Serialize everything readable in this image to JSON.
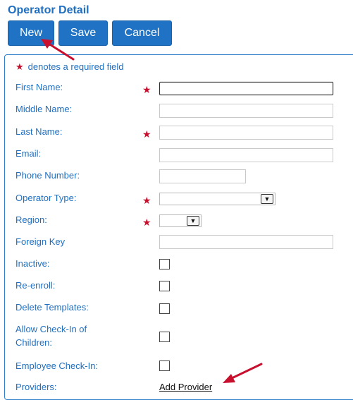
{
  "header": {
    "title": "Operator Detail"
  },
  "toolbar": {
    "new_label": "New",
    "save_label": "Save",
    "cancel_label": "Cancel"
  },
  "form": {
    "required_note": "denotes a required field",
    "required_mark": "★",
    "fields": {
      "first_name": {
        "label": "First Name:",
        "value": ""
      },
      "middle_name": {
        "label": "Middle Name:",
        "value": ""
      },
      "last_name": {
        "label": "Last Name:",
        "value": ""
      },
      "email": {
        "label": "Email:",
        "value": ""
      },
      "phone_number": {
        "label": "Phone Number:",
        "value": ""
      },
      "operator_type": {
        "label": "Operator Type:",
        "value": ""
      },
      "region": {
        "label": "Region:",
        "value": ""
      },
      "foreign_key": {
        "label": "Foreign Key",
        "value": ""
      },
      "inactive": {
        "label": "Inactive:",
        "checked": false
      },
      "re_enroll": {
        "label": "Re-enroll:",
        "checked": false
      },
      "delete_templates": {
        "label": "Delete Templates:",
        "checked": false
      },
      "allow_checkin_line1": {
        "label": "Allow Check-In of"
      },
      "allow_checkin_line2": {
        "label": "Children:",
        "checked": false
      },
      "employee_checkin": {
        "label": "Employee Check-In:",
        "checked": false
      },
      "providers": {
        "label": "Providers:",
        "link": "Add Provider"
      }
    }
  },
  "colors": {
    "accent": "#1f72c4",
    "label": "#1f6fc1",
    "required": "#c8102e",
    "annotation_arrow": "#c8102e"
  },
  "icons": {
    "required": "star-icon",
    "dropdown": "chevron-down-icon",
    "annotation": "red-arrow-icon"
  }
}
